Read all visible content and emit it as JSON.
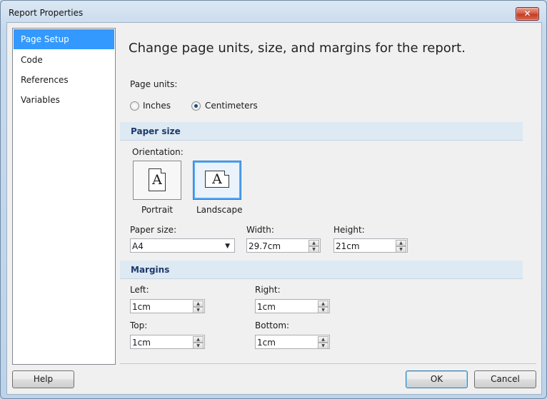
{
  "window": {
    "title": "Report Properties",
    "close_glyph": "✕"
  },
  "nav": {
    "items": [
      {
        "label": "Page Setup",
        "selected": true
      },
      {
        "label": "Code",
        "selected": false
      },
      {
        "label": "References",
        "selected": false
      },
      {
        "label": "Variables",
        "selected": false
      }
    ]
  },
  "main": {
    "heading": "Change page units, size, and margins for the report.",
    "page_units": {
      "label": "Page units:",
      "options": [
        {
          "label": "Inches",
          "checked": false
        },
        {
          "label": "Centimeters",
          "checked": true
        }
      ]
    },
    "paper_section": {
      "title": "Paper size",
      "orientation_label": "Orientation:",
      "portrait_label": "Portrait",
      "landscape_label": "Landscape",
      "selected_orientation": "Landscape",
      "icon_letter": "A",
      "paper_size_label": "Paper size:",
      "paper_size_value": "A4",
      "width_label": "Width:",
      "width_value": "29.7cm",
      "height_label": "Height:",
      "height_value": "21cm"
    },
    "margins_section": {
      "title": "Margins",
      "left_label": "Left:",
      "left_value": "1cm",
      "right_label": "Right:",
      "right_value": "1cm",
      "top_label": "Top:",
      "top_value": "1cm",
      "bottom_label": "Bottom:",
      "bottom_value": "1cm"
    }
  },
  "footer": {
    "help_label": "Help",
    "ok_label": "OK",
    "cancel_label": "Cancel"
  },
  "colors": {
    "selection": "#3399ff",
    "section_bg": "#dde9f3",
    "section_text": "#1e3a6b"
  }
}
